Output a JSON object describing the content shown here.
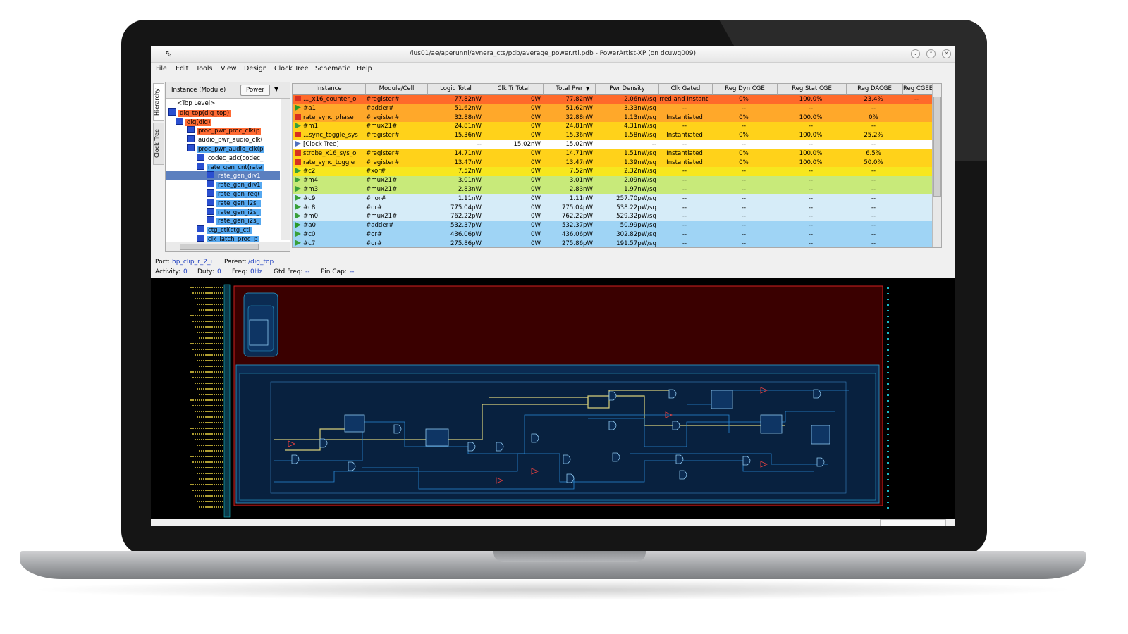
{
  "window": {
    "title": "/lus01/ae/aperunnl/avnera_cts/pdb/average_power.rtl.pdb - PowerArtist-XP (on dcuwq009)"
  },
  "menu": [
    "File",
    "Edit",
    "Tools",
    "View",
    "Design",
    "Clock Tree",
    "Schematic",
    "Help"
  ],
  "side_tabs": [
    "Hierarchy",
    "Clock Tree"
  ],
  "hierarchy": {
    "column_label": "Instance (Module)",
    "dropdown_value": "Power",
    "items": [
      {
        "label": "<Top Level>",
        "color": "#ffffff"
      },
      {
        "label": "dig_top(dig_top)",
        "color": "#ff6a33"
      },
      {
        "label": "dig(dig)",
        "color": "#ff6a33"
      },
      {
        "label": "proc_pwr_proc_clk(p",
        "color": "#ff6a33"
      },
      {
        "label": "audio_pwr_audio_clk(",
        "color": "#ffffff"
      },
      {
        "label": "proc_pwr_audio_clk(p",
        "color": "#55a8f0"
      },
      {
        "label": "codec_adc(codec_",
        "color": "#ffffff"
      },
      {
        "label": "rate_gen_cnt(rate",
        "color": "#55a8f0"
      },
      {
        "label": "rate_gen_div1",
        "color": "#5b7fbf"
      },
      {
        "label": "rate_gen_div1",
        "color": "#55a8f0"
      },
      {
        "label": "rate_gen_reg(",
        "color": "#55a8f0"
      },
      {
        "label": "rate_gen_i2s_",
        "color": "#55a8f0"
      },
      {
        "label": "rate_gen_i2s_",
        "color": "#55a8f0"
      },
      {
        "label": "rate_gen_i2s_",
        "color": "#55a8f0"
      },
      {
        "label": "ctg_ctl(ctg_ctl",
        "color": "#55a8f0"
      },
      {
        "label": "clk_latch_proc_p",
        "color": "#55a8f0"
      }
    ]
  },
  "table": {
    "headers": [
      "Instance",
      "Module/Cell",
      "Logic Total",
      "Clk Tr Total",
      "Total Pwr",
      "Pwr Density",
      "Clk Gated",
      "Reg Dyn CGE",
      "Reg Stat CGE",
      "Reg DACGE",
      "Reg CGEE"
    ],
    "rows": [
      {
        "icon": "register-icon",
        "cells": [
          "..._x16_counter_o",
          "#register#",
          "77.82nW",
          "0W",
          "77.82nW",
          "2.06nW/sq",
          "rred and Instanti",
          "0%",
          "100.0%",
          "23.4%",
          "--"
        ],
        "bg": "#ff6a2a"
      },
      {
        "icon": "adder-icon",
        "cells": [
          "#a1",
          "#adder#",
          "51.62nW",
          "0W",
          "51.62nW",
          "3.33nW/sq",
          "--",
          "--",
          "--",
          "--",
          ""
        ],
        "bg": "#ffa82a"
      },
      {
        "icon": "register-icon",
        "cells": [
          "rate_sync_phase",
          "#register#",
          "32.88nW",
          "0W",
          "32.88nW",
          "1.13nW/sq",
          "Instantiated",
          "0%",
          "100.0%",
          "0%",
          ""
        ],
        "bg": "#ffa82a"
      },
      {
        "icon": "mux-icon",
        "cells": [
          "#m1",
          "#mux21#",
          "24.81nW",
          "0W",
          "24.81nW",
          "4.31nW/sq",
          "--",
          "--",
          "--",
          "--",
          ""
        ],
        "bg": "#ffd21a"
      },
      {
        "icon": "register-icon",
        "cells": [
          "...sync_toggle_sys",
          "#register#",
          "15.36nW",
          "0W",
          "15.36nW",
          "1.58nW/sq",
          "Instantiated",
          "0%",
          "100.0%",
          "25.2%",
          ""
        ],
        "bg": "#ffd21a"
      },
      {
        "icon": "clock-tree-icon",
        "cells": [
          "[Clock Tree]",
          "",
          "--",
          "15.02nW",
          "15.02nW",
          "--",
          "--",
          "--",
          "--",
          "--",
          ""
        ],
        "bg": "#ffffff"
      },
      {
        "icon": "register-icon",
        "cells": [
          "strobe_x16_sys_o",
          "#register#",
          "14.71nW",
          "0W",
          "14.71nW",
          "1.51nW/sq",
          "Instantiated",
          "0%",
          "100.0%",
          "6.5%",
          ""
        ],
        "bg": "#ffd21a"
      },
      {
        "icon": "register-icon",
        "cells": [
          "rate_sync_toggle",
          "#register#",
          "13.47nW",
          "0W",
          "13.47nW",
          "1.39nW/sq",
          "Instantiated",
          "0%",
          "100.0%",
          "50.0%",
          ""
        ],
        "bg": "#ffd21a"
      },
      {
        "icon": "xor-icon",
        "cells": [
          "#c2",
          "#xor#",
          "7.52nW",
          "0W",
          "7.52nW",
          "2.32nW/sq",
          "--",
          "--",
          "--",
          "--",
          ""
        ],
        "bg": "#f7e71e"
      },
      {
        "icon": "mux-icon",
        "cells": [
          "#m4",
          "#mux21#",
          "3.01nW",
          "0W",
          "3.01nW",
          "2.09nW/sq",
          "--",
          "--",
          "--",
          "--",
          ""
        ],
        "bg": "#c8ea7a"
      },
      {
        "icon": "mux-icon",
        "cells": [
          "#m3",
          "#mux21#",
          "2.83nW",
          "0W",
          "2.83nW",
          "1.97nW/sq",
          "--",
          "--",
          "--",
          "--",
          ""
        ],
        "bg": "#c8ea7a"
      },
      {
        "icon": "nor-icon",
        "cells": [
          "#c9",
          "#nor#",
          "1.11nW",
          "0W",
          "1.11nW",
          "257.70pW/sq",
          "--",
          "--",
          "--",
          "--",
          ""
        ],
        "bg": "#d6ecf8"
      },
      {
        "icon": "or-icon",
        "cells": [
          "#c8",
          "#or#",
          "775.04pW",
          "0W",
          "775.04pW",
          "538.22pW/sq",
          "--",
          "--",
          "--",
          "--",
          ""
        ],
        "bg": "#d6ecf8"
      },
      {
        "icon": "mux-icon",
        "cells": [
          "#m0",
          "#mux21#",
          "762.22pW",
          "0W",
          "762.22pW",
          "529.32pW/sq",
          "--",
          "--",
          "--",
          "--",
          ""
        ],
        "bg": "#d6ecf8"
      },
      {
        "icon": "adder-icon",
        "cells": [
          "#a0",
          "#adder#",
          "532.37pW",
          "0W",
          "532.37pW",
          "50.99pW/sq",
          "--",
          "--",
          "--",
          "--",
          ""
        ],
        "bg": "#9fd4f5"
      },
      {
        "icon": "or-icon",
        "cells": [
          "#c0",
          "#or#",
          "436.06pW",
          "0W",
          "436.06pW",
          "302.82pW/sq",
          "--",
          "--",
          "--",
          "--",
          ""
        ],
        "bg": "#9fd4f5"
      },
      {
        "icon": "or-icon",
        "cells": [
          "#c7",
          "#or#",
          "275.86pW",
          "0W",
          "275.86pW",
          "191.57pW/sq",
          "--",
          "--",
          "--",
          "--",
          ""
        ],
        "bg": "#9fd4f5"
      }
    ]
  },
  "status": {
    "port_label": "Port:",
    "port_value": "hp_clip_r_2_i",
    "parent_label": "Parent:",
    "parent_value": "/dig_top",
    "activity_label": "Activity:",
    "activity_value": "0",
    "duty_label": "Duty:",
    "duty_value": "0",
    "freq_label": "Freq:",
    "freq_value": "0Hz",
    "gtd_label": "Gtd Freq:",
    "gtd_value": "--",
    "pincap_label": "Pin Cap:",
    "pincap_value": "--"
  },
  "colors": {
    "power_hot": "#ff6a2a",
    "power_warm": "#ffa82a",
    "power_mid": "#ffd21a",
    "power_low": "#c8ea7a",
    "power_cool": "#9fd4f5",
    "schematic_bg": "#000000",
    "schematic_module": "#3a0000",
    "schematic_inner": "#0b2b52",
    "schematic_wire": "#d8d07a"
  }
}
